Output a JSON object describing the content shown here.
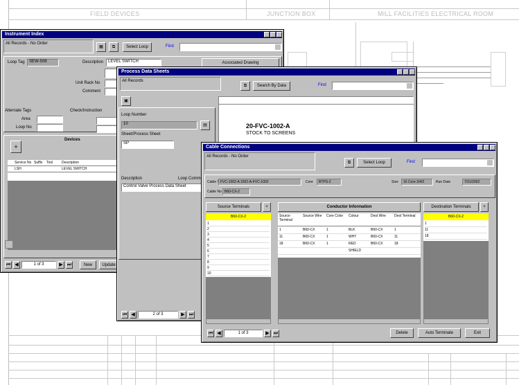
{
  "drawing": {
    "col_field": "FIELD DEVICES",
    "col_junction": "JUNCTION BOX",
    "col_mill": "MILL FACILITIES ELECTRICAL ROOM"
  },
  "instrument_index": {
    "title": "Instrument Index",
    "records": "All Records - No Order",
    "select_loop": "Select Loop",
    "find": "Find",
    "loop_tag_label": "Loop Tag",
    "loop_tag_value": "SEW-508",
    "description_label": "Description",
    "description_value": "LEVEL SWITCH",
    "associated_drawing": "Associated Drawing",
    "unit_rack_no": "Unit Rack No",
    "comment": "Comment",
    "alternate_tags": "Alternate Tags",
    "area": "Area",
    "loop_no": "Loop No",
    "checklist": "Check/Instruction",
    "devices": "Devices",
    "grid_headers": [
      "Service No",
      "Suffix",
      "Tool",
      "Description"
    ],
    "grid_row": [
      "LSH",
      "",
      "",
      "LEVEL SWITCH"
    ],
    "record_nav": "1 of 3",
    "btn_new": "New",
    "btn_update": "Update"
  },
  "process_data": {
    "title": "Process Data Sheets",
    "all_records": "All Records",
    "search_by_data": "Search By Data",
    "find": "Find",
    "loop_number": "Loop Number",
    "loop_number_value": "10",
    "process_sheet": "Sheet/Process Sheet",
    "process_sheet_value": "SP",
    "description": "Description",
    "loop_comment": "Loop Comment",
    "description_value": "Control Valve Process Data Sheet",
    "preview_line1": "20-FVC-1002-A",
    "preview_line2": "STOCK TO SCREENS",
    "record_nav": "2 of 3"
  },
  "cable_connections": {
    "title": "Cable Connections",
    "records": "All Records - No Order",
    "select_loop": "Select Loop",
    "find": "Find",
    "cable_tag_label": "Cable Tag",
    "cable_tag_value": "FVC-1002-A 1002-A-FVC-1002",
    "cable_no_label": "Cable No",
    "cable_no_value": "B60-CX-2",
    "core_label": "Core",
    "core_value": "BTPS-2",
    "size_label": "Size",
    "size_value": "16 Core 3/4/2",
    "run_date_label": "Run Date",
    "run_date_value": "7/31/2002",
    "source_terminals": "Source Terminals",
    "conductor_information": "Conductor Information",
    "destination_terminals": "Destination Terminals",
    "source_selected": "B60-CX-2",
    "source_rows": [
      "1",
      "2",
      "3",
      "4",
      "5",
      "6",
      "7",
      "8",
      "9",
      "10"
    ],
    "dest_selected": "B60-CX-2",
    "dest_rows": [
      "1",
      "11",
      "18"
    ],
    "conductor_headers": [
      "Source Terminal",
      "Source Wire",
      "Core Color",
      "Colour",
      "Dest Wire",
      "Dest Terminal"
    ],
    "conductor_rows": [
      [
        "1",
        "B60-CX",
        "1",
        "BLK",
        "B60-CX",
        "1"
      ],
      [
        "11",
        "B60-CX",
        "1",
        "WHT",
        "B60-CX",
        "11"
      ],
      [
        "18",
        "B60-CX",
        "1",
        "RED",
        "B60-CX",
        "18"
      ],
      [
        "",
        "",
        "",
        "SHIELD",
        "",
        ""
      ]
    ],
    "record_nav": "1 of 3",
    "btn_delete": "Delete",
    "btn_auto_terminate": "Auto Terminate",
    "btn_exit": "Exit"
  },
  "colors": {
    "title_bar": "#000080",
    "window_face": "#c0c0c0",
    "highlight": "#ffff00"
  }
}
